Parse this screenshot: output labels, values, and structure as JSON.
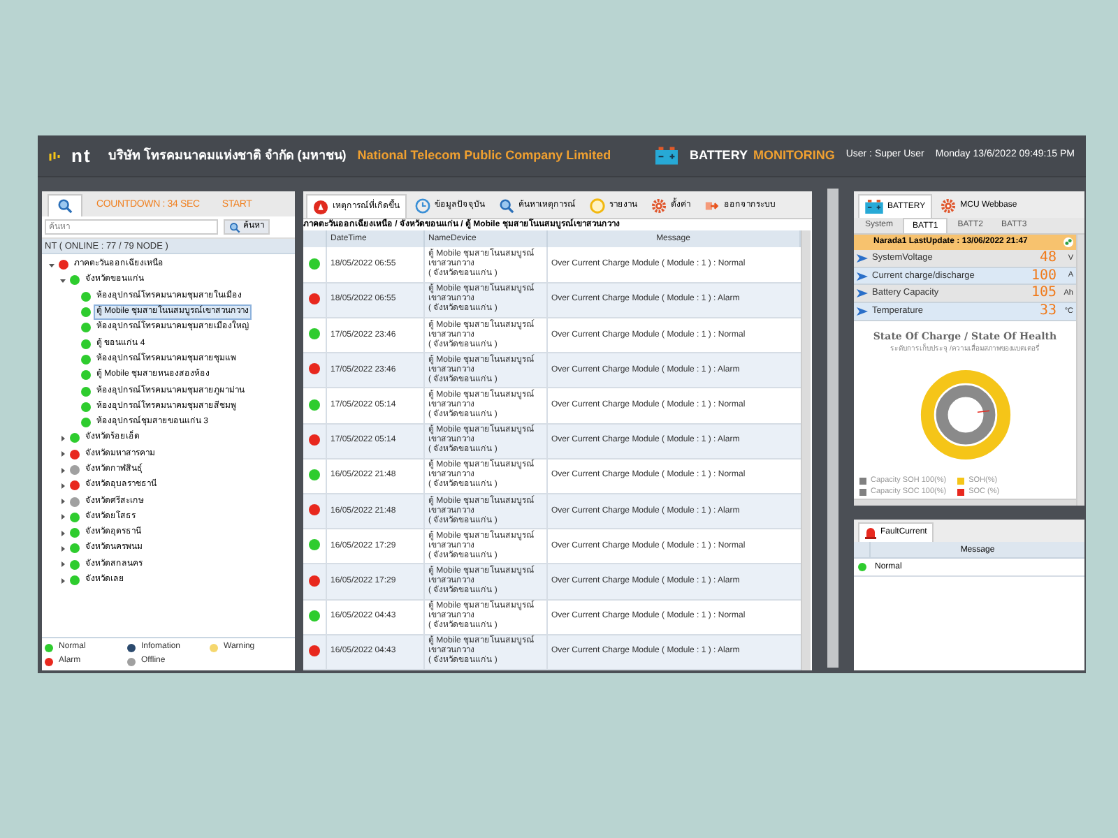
{
  "header": {
    "logo": "nt",
    "company_th": "บริษัท โทรคมนาคมแห่งชาติ จำกัด (มหาชน)",
    "company_en": "National Telecom Public Company Limited",
    "title_1": "BATTERY",
    "title_2": "MONITORING",
    "user": "User : Super User",
    "datetime": "Monday 13/6/2022 09:49:15 PM"
  },
  "left_panel": {
    "tabs": [
      {
        "kind": "search",
        "selected": true
      },
      {
        "kind": "text",
        "label": "COUNTDOWN : 34 SEC",
        "selected": false
      },
      {
        "kind": "text",
        "label": "START",
        "selected": false
      }
    ],
    "search": {
      "placeholder": "ค้นหา",
      "button": "ค้นหา"
    },
    "status_line": "NT ( ONLINE : 77 / 79 NODE )",
    "tree": [
      {
        "label": "ภาคตะวันออกเฉียงเหนือ",
        "color": "#e8281e",
        "expanded": true,
        "selected": false,
        "children": [
          {
            "label": "จังหวัดขอนแก่น",
            "color": "#2ecc2e",
            "expanded": true,
            "selected": false,
            "children": [
              {
                "label": "ห้องอุปกรณ์โทรคมนาคมชุมสายในเมือง",
                "color": "#2ecc2e",
                "selected": false
              },
              {
                "label": "ตู้ Mobile ชุมสายโนนสมบูรณ์เขาสวนกวาง",
                "color": "#2ecc2e",
                "selected": true
              },
              {
                "label": "ห้องอุปกรณ์โทรคมนาคมชุมสายเมืองใหญ่",
                "color": "#2ecc2e",
                "selected": false
              },
              {
                "label": "ตู้ ขอนแก่น 4",
                "color": "#2ecc2e",
                "selected": false
              },
              {
                "label": "ห้องอุปกรณ์โทรคมนาคมชุมสายชุมแพ",
                "color": "#2ecc2e",
                "selected": false
              },
              {
                "label": "ตู้ Mobile ชุมสายหนองสองห้อง",
                "color": "#2ecc2e",
                "selected": false
              },
              {
                "label": "ห้องอุปกรณ์โทรคมนาคมชุมสายภูผาม่าน",
                "color": "#2ecc2e",
                "selected": false
              },
              {
                "label": "ห้องอุปกรณ์โทรคมนาคมชุมสายสีชมพู",
                "color": "#2ecc2e",
                "selected": false
              },
              {
                "label": "ห้องอุปกรณ์ชุมสายขอนแก่น 3",
                "color": "#2ecc2e",
                "selected": false
              }
            ]
          },
          {
            "label": "จังหวัดร้อยเอ็ด",
            "color": "#2ecc2e",
            "expanded": false,
            "selected": false
          },
          {
            "label": "จังหวัดมหาสารคาม",
            "color": "#e8281e",
            "expanded": false,
            "selected": false
          },
          {
            "label": "จังหวัดกาฬสินธุ์",
            "color": "#a0a0a0",
            "expanded": false,
            "selected": false
          },
          {
            "label": "จังหวัดอุบลราชธานี",
            "color": "#e8281e",
            "expanded": false,
            "selected": false
          },
          {
            "label": "จังหวัดศรีสะเกษ",
            "color": "#a0a0a0",
            "expanded": false,
            "selected": false
          },
          {
            "label": "จังหวัดยโสธร",
            "color": "#2ecc2e",
            "expanded": false,
            "selected": false
          },
          {
            "label": "จังหวัดอุดรธานี",
            "color": "#2ecc2e",
            "expanded": false,
            "selected": false
          },
          {
            "label": "จังหวัดนครพนม",
            "color": "#2ecc2e",
            "expanded": false,
            "selected": false
          },
          {
            "label": "จังหวัดสกลนคร",
            "color": "#2ecc2e",
            "expanded": false,
            "selected": false
          },
          {
            "label": "จังหวัดเลย",
            "color": "#2ecc2e",
            "expanded": false,
            "selected": false
          }
        ]
      }
    ],
    "legend": [
      {
        "label": "Normal",
        "color": "#2ecc2e"
      },
      {
        "label": "Infomation",
        "color": "#2c4a6e"
      },
      {
        "label": "Warning",
        "color": "#f5d76e"
      },
      {
        "label": "Alarm",
        "color": "#e8281e"
      },
      {
        "label": "Offline",
        "color": "#a0a0a0"
      }
    ]
  },
  "center_panel": {
    "tabs": [
      {
        "kind": "alert",
        "label": "เหตุการณ์ที่เกิดขึ้น",
        "selected": true
      },
      {
        "kind": "clock",
        "label": "ข้อมูลปัจจุบัน",
        "selected": false
      },
      {
        "kind": "search",
        "label": "ค้นหาเหตุการณ์",
        "selected": false
      },
      {
        "kind": "report",
        "label": "รายงาน",
        "selected": false
      },
      {
        "kind": "gear",
        "label": "ตั้งค่า",
        "selected": false
      },
      {
        "kind": "exit",
        "label": "ออกจากระบบ",
        "selected": false
      }
    ],
    "breadcrumb": "ภาคตะวันออกเฉียงเหนือ / จังหวัดขอนแก่น / ตู้ Mobile ชุมสายโนนสมบูรณ์เขาสวนกวาง",
    "table": {
      "columns": [
        "DateTime",
        "NameDevice",
        "Message"
      ],
      "rows": [
        {
          "color": "#2ecc2e",
          "datetime": "18/05/2022 06:55",
          "device": "ตู้ Mobile ชุมสายโนนสมบูรณ์เขาสวนกวาง",
          "province": "( จังหวัดขอนแก่น )",
          "message": "Over Current Charge Module ( Module : 1 ) : Normal"
        },
        {
          "color": "#e8281e",
          "datetime": "18/05/2022 06:55",
          "device": "ตู้ Mobile ชุมสายโนนสมบูรณ์เขาสวนกวาง",
          "province": "( จังหวัดขอนแก่น )",
          "message": "Over Current Charge Module ( Module : 1 ) : Alarm"
        },
        {
          "color": "#2ecc2e",
          "datetime": "17/05/2022 23:46",
          "device": "ตู้ Mobile ชุมสายโนนสมบูรณ์เขาสวนกวาง",
          "province": "( จังหวัดขอนแก่น )",
          "message": "Over Current Charge Module ( Module : 1 ) : Normal"
        },
        {
          "color": "#e8281e",
          "datetime": "17/05/2022 23:46",
          "device": "ตู้ Mobile ชุมสายโนนสมบูรณ์เขาสวนกวาง",
          "province": "( จังหวัดขอนแก่น )",
          "message": "Over Current Charge Module ( Module : 1 ) : Alarm"
        },
        {
          "color": "#2ecc2e",
          "datetime": "17/05/2022 05:14",
          "device": "ตู้ Mobile ชุมสายโนนสมบูรณ์เขาสวนกวาง",
          "province": "( จังหวัดขอนแก่น )",
          "message": "Over Current Charge Module ( Module : 1 ) : Normal"
        },
        {
          "color": "#e8281e",
          "datetime": "17/05/2022 05:14",
          "device": "ตู้ Mobile ชุมสายโนนสมบูรณ์เขาสวนกวาง",
          "province": "( จังหวัดขอนแก่น )",
          "message": "Over Current Charge Module ( Module : 1 ) : Alarm"
        },
        {
          "color": "#2ecc2e",
          "datetime": "16/05/2022 21:48",
          "device": "ตู้ Mobile ชุมสายโนนสมบูรณ์เขาสวนกวาง",
          "province": "( จังหวัดขอนแก่น )",
          "message": "Over Current Charge Module ( Module : 1 ) : Normal"
        },
        {
          "color": "#e8281e",
          "datetime": "16/05/2022 21:48",
          "device": "ตู้ Mobile ชุมสายโนนสมบูรณ์เขาสวนกวาง",
          "province": "( จังหวัดขอนแก่น )",
          "message": "Over Current Charge Module ( Module : 1 ) : Alarm"
        },
        {
          "color": "#2ecc2e",
          "datetime": "16/05/2022 17:29",
          "device": "ตู้ Mobile ชุมสายโนนสมบูรณ์เขาสวนกวาง",
          "province": "( จังหวัดขอนแก่น )",
          "message": "Over Current Charge Module ( Module : 1 ) : Normal"
        },
        {
          "color": "#e8281e",
          "datetime": "16/05/2022 17:29",
          "device": "ตู้ Mobile ชุมสายโนนสมบูรณ์เขาสวนกวาง",
          "province": "( จังหวัดขอนแก่น )",
          "message": "Over Current Charge Module ( Module : 1 ) : Alarm"
        },
        {
          "color": "#2ecc2e",
          "datetime": "16/05/2022 04:43",
          "device": "ตู้ Mobile ชุมสายโนนสมบูรณ์เขาสวนกวาง",
          "province": "( จังหวัดขอนแก่น )",
          "message": "Over Current Charge Module ( Module : 1 ) : Normal"
        },
        {
          "color": "#e8281e",
          "datetime": "16/05/2022 04:43",
          "device": "ตู้ Mobile ชุมสายโนนสมบูรณ์เขาสวนกวาง",
          "province": "( จังหวัดขอนแก่น )",
          "message": "Over Current Charge Module ( Module : 1 ) : Alarm"
        }
      ]
    }
  },
  "battery_panel": {
    "tabs": [
      {
        "kind": "battery",
        "label": "BATTERY",
        "selected": true
      },
      {
        "kind": "gear",
        "label": "MCU Webbase",
        "selected": false
      }
    ],
    "subtabs": [
      {
        "label": "System",
        "selected": false
      },
      {
        "label": "BATT1",
        "selected": true
      },
      {
        "label": "BATT2",
        "selected": false
      },
      {
        "label": "BATT3",
        "selected": false
      }
    ],
    "banner": "Narada1 LastUpdate : 13/06/2022 21:47",
    "metrics": [
      {
        "label": "SystemVoltage",
        "value": "48",
        "unit": "V"
      },
      {
        "label": "Current charge/discharge",
        "value": "100",
        "unit": "A"
      },
      {
        "label": "Battery Capacity",
        "value": "105",
        "unit": "Ah"
      },
      {
        "label": "Temperature",
        "value": "33",
        "unit": "°C"
      }
    ],
    "chart_title": "State Of Charge / State Of Health",
    "chart_subtitle": "ระดับการเก็บประจุ /ความเสื่อมสภาพของแบตเตอรี่",
    "legend": [
      {
        "label": "Capacity SOH 100(%)",
        "color": "#808080"
      },
      {
        "label": "SOH(%)",
        "color": "#f5c518"
      },
      {
        "label": "Capacity SOC 100(%)",
        "color": "#808080"
      },
      {
        "label": "SOC (%)",
        "color": "#e8281e"
      }
    ]
  },
  "fault_panel": {
    "tab": "FaultCurrent",
    "column": "Message",
    "rows": [
      {
        "color": "#2ecc2e",
        "message": "Normal"
      }
    ]
  }
}
